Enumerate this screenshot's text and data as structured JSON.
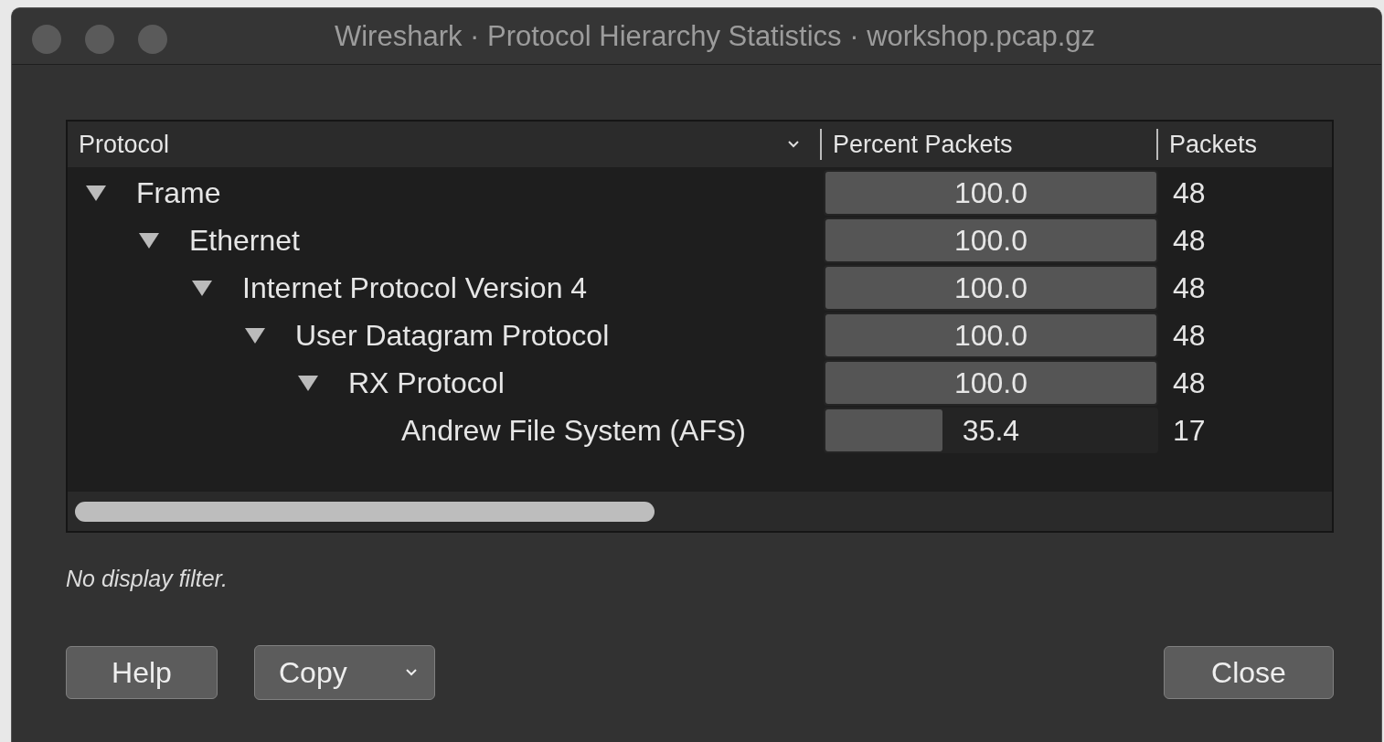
{
  "window": {
    "title": "Wireshark · Protocol Hierarchy Statistics · workshop.pcap.gz"
  },
  "table": {
    "columns": [
      "Protocol",
      "Percent Packets",
      "Packets"
    ],
    "rows": [
      {
        "name": "Frame",
        "expanded": true,
        "percent": "100.0",
        "level": 1,
        "packets": "48",
        "children": [
          {
            "name": "Ethernet",
            "expanded": true,
            "percent": "100.0",
            "level": 1,
            "packets": "48",
            "children": [
              {
                "name": "Internet Protocol Version 4",
                "expanded": true,
                "percent": "100.0",
                "level": 1,
                "packets": "48",
                "children": [
                  {
                    "name": "User Datagram Protocol",
                    "expanded": true,
                    "percent": "100.0",
                    "level": 1,
                    "packets": "48",
                    "children": [
                      {
                        "name": "RX Protocol",
                        "expanded": true,
                        "percent": "100.0",
                        "level": 1,
                        "packets": "48",
                        "children": [
                          {
                            "name": "Andrew File System (AFS)",
                            "percent": "35.4",
                            "level": 0.354,
                            "packets": "17"
                          }
                        ]
                      }
                    ]
                  }
                ]
              }
            ]
          }
        ]
      }
    ]
  },
  "status": "No display filter.",
  "buttons": {
    "help": "Help",
    "copy": "Copy",
    "close": "Close"
  }
}
